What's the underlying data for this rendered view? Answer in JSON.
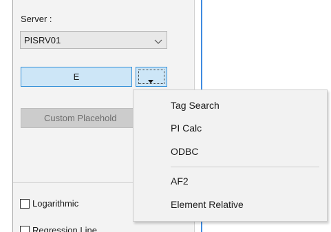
{
  "server": {
    "label": "Server :",
    "selected": "PISRV01"
  },
  "buttons": {
    "e_label": "E",
    "custom_placeholder_label": "Custom Placehold"
  },
  "checkboxes": [
    {
      "label": "Logarithmic",
      "checked": false
    },
    {
      "label": "Regression Line",
      "checked": false
    }
  ],
  "dropdown_menu": {
    "items": [
      "Tag Search",
      "PI Calc",
      "ODBC",
      "AF2",
      "Element Relative"
    ]
  },
  "colors": {
    "accent_blue": "#2f8ed8",
    "button_fill": "#cde6f7",
    "panel_bg": "#f3f3f3",
    "menu_bg": "#f2f2f2",
    "divider_blue": "#3f8be0"
  },
  "icons": {
    "server_dropdown": "chevron-down-icon",
    "menu_toggle": "caret-down-icon"
  }
}
